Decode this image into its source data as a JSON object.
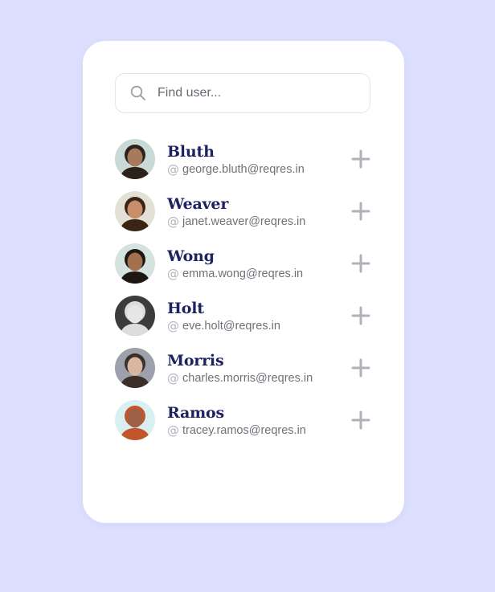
{
  "search": {
    "placeholder": "Find user...",
    "value": ""
  },
  "users": [
    {
      "name": "Bluth",
      "email": "george.bluth@reqres.in",
      "avatar_bg": "#c8d9d6",
      "skin": "#a77a5c",
      "hair": "#2b221c"
    },
    {
      "name": "Weaver",
      "email": "janet.weaver@reqres.in",
      "avatar_bg": "#e3e0d6",
      "skin": "#c68e6a",
      "hair": "#3a2416"
    },
    {
      "name": "Wong",
      "email": "emma.wong@reqres.in",
      "avatar_bg": "#d4e2e0",
      "skin": "#a3704f",
      "hair": "#1d1712"
    },
    {
      "name": "Holt",
      "email": "eve.holt@reqres.in",
      "avatar_bg": "#3c3c3c",
      "skin": "#e7e7e7",
      "hair": "#dddddd"
    },
    {
      "name": "Morris",
      "email": "charles.morris@reqres.in",
      "avatar_bg": "#9da1ab",
      "skin": "#d8b6a0",
      "hair": "#3b3029"
    },
    {
      "name": "Ramos",
      "email": "tracey.ramos@reqres.in",
      "avatar_bg": "#d8f0f2",
      "skin": "#9c6146",
      "hair": "#c2552b"
    }
  ],
  "icons": {
    "search": "search-icon",
    "at": "at-icon",
    "add": "plus-icon"
  },
  "colors": {
    "background": "#dcdffe",
    "card": "#ffffff",
    "name": "#1f2260",
    "email": "#6e7178",
    "plus": "#b0b2b8"
  }
}
